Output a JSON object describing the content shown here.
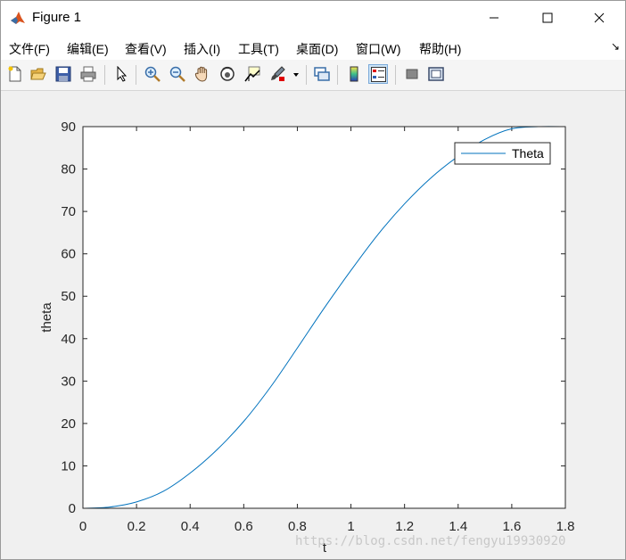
{
  "window": {
    "title": "Figure 1",
    "controls": {
      "minimize": "minimize-icon",
      "maximize": "maximize-icon",
      "close": "close-icon"
    }
  },
  "menubar": {
    "items": [
      "文件(F)",
      "编辑(E)",
      "查看(V)",
      "插入(I)",
      "工具(T)",
      "桌面(D)",
      "窗口(W)",
      "帮助(H)"
    ]
  },
  "toolbar": {
    "icons": [
      "new-figure-icon",
      "open-file-icon",
      "save-icon",
      "print-icon",
      "pointer-icon",
      "zoom-in-icon",
      "zoom-out-icon",
      "pan-hand-icon",
      "rotate-3d-icon",
      "data-cursor-icon",
      "brush-icon",
      "link-plot-icon",
      "colorbar-icon",
      "legend-icon",
      "hide-plot-tools-icon",
      "show-plot-tools-icon"
    ]
  },
  "chart_data": {
    "type": "line",
    "title": "",
    "xlabel": "t",
    "ylabel": "theta",
    "xlim": [
      0,
      1.8
    ],
    "ylim": [
      0,
      90
    ],
    "xticks": [
      0,
      0.2,
      0.4,
      0.6,
      0.8,
      1,
      1.2,
      1.4,
      1.6,
      1.8
    ],
    "yticks": [
      0,
      10,
      20,
      30,
      40,
      50,
      60,
      70,
      80,
      90
    ],
    "xtick_labels": [
      "0",
      "0.2",
      "0.4",
      "0.6",
      "0.8",
      "1",
      "1.2",
      "1.4",
      "1.6",
      "1.8"
    ],
    "ytick_labels": [
      "0",
      "10",
      "20",
      "30",
      "40",
      "50",
      "60",
      "70",
      "80",
      "90"
    ],
    "grid": false,
    "legend": {
      "position": "top-right",
      "entries": [
        "Theta"
      ]
    },
    "series": [
      {
        "name": "Theta",
        "color": "#0072bd",
        "x": [
          0,
          0.1,
          0.2,
          0.3,
          0.4,
          0.5,
          0.6,
          0.7,
          0.8,
          0.9,
          1.0,
          1.1,
          1.2,
          1.3,
          1.4,
          1.5,
          1.6,
          1.7,
          1.8
        ],
        "y": [
          0,
          0.3,
          1.5,
          4.0,
          8.3,
          13.8,
          20.5,
          28.6,
          37.8,
          47.2,
          56.1,
          64.5,
          71.8,
          78.0,
          83.0,
          87.0,
          89.5,
          90.0,
          90.0
        ]
      }
    ]
  },
  "watermark": "https://blog.csdn.net/fengyu19930920"
}
